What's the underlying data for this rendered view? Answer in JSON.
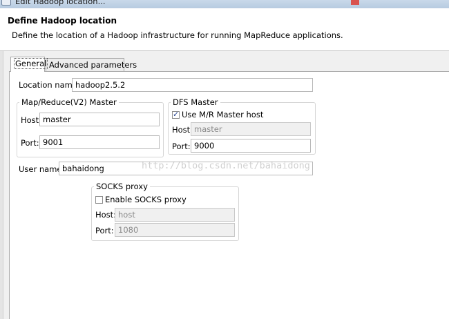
{
  "window": {
    "title": "Edit Hadoop location..."
  },
  "header": {
    "title": "Define Hadoop location",
    "description": "Define the location of a Hadoop infrastructure for running MapReduce applications."
  },
  "tabs": [
    {
      "label": "General",
      "selected": true
    },
    {
      "label": "Advanced parameters",
      "selected": false
    }
  ],
  "general": {
    "location_name_label": "Location name:",
    "location_name_value": "hadoop2.5.2",
    "mapreduce_group": {
      "title": "Map/Reduce(V2) Master",
      "host_label": "Host:",
      "host_value": "master",
      "port_label": "Port:",
      "port_value": "9001"
    },
    "dfs_group": {
      "title": "DFS Master",
      "use_mr_label": "Use M/R Master host",
      "use_mr_checked": true,
      "host_label": "Host:",
      "host_value": "master",
      "port_label": "Port:",
      "port_value": "9000"
    },
    "user_name_label": "User name:",
    "user_name_value": "bahaidong",
    "socks_group": {
      "title": "SOCKS proxy",
      "enable_label": "Enable SOCKS proxy",
      "enable_checked": false,
      "host_label": "Host:",
      "host_value": "host",
      "port_label": "Port:",
      "port_value": "1080"
    }
  },
  "watermark": "http://blog.csdn.net/bahaidong"
}
